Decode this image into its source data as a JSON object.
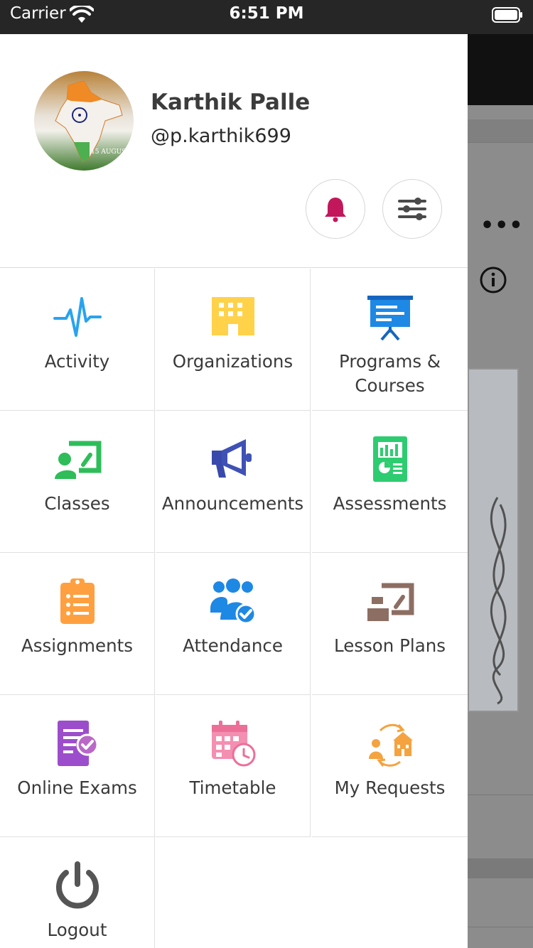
{
  "status_bar": {
    "carrier": "Carrier",
    "time": "6:51 PM"
  },
  "profile": {
    "name": "Karthik Palle",
    "handle": "@p.karthik699",
    "avatar_caption": "15 AUGUST"
  },
  "header_actions": {
    "notifications_icon": "bell-icon",
    "filter_icon": "sliders-icon"
  },
  "menu": [
    {
      "label": "Activity",
      "icon": "pulse-icon",
      "color": "#2196f3"
    },
    {
      "label": "Organizations",
      "icon": "building-icon",
      "color": "#ffd64d"
    },
    {
      "label": "Programs & Courses",
      "icon": "presentation-board-icon",
      "color": "#1e88e5"
    },
    {
      "label": "Classes",
      "icon": "teacher-board-icon",
      "color": "#2ebd59"
    },
    {
      "label": "Announcements",
      "icon": "megaphone-icon",
      "color": "#3f51b5"
    },
    {
      "label": "Assessments",
      "icon": "report-chart-icon",
      "color": "#2ecc71"
    },
    {
      "label": "Assignments",
      "icon": "clipboard-list-icon",
      "color": "#ff9f43"
    },
    {
      "label": "Attendance",
      "icon": "users-check-icon",
      "color": "#1e88e5"
    },
    {
      "label": "Lesson Plans",
      "icon": "lesson-board-icon",
      "color": "#8d6e63"
    },
    {
      "label": "Online Exams",
      "icon": "exam-check-icon",
      "color": "#9c4dcc"
    },
    {
      "label": "Timetable",
      "icon": "calendar-clock-icon",
      "color": "#ef7fa0"
    },
    {
      "label": "My Requests",
      "icon": "request-exchange-icon",
      "color": "#f4a340"
    },
    {
      "label": "Logout",
      "icon": "power-icon",
      "color": "#555555"
    }
  ]
}
